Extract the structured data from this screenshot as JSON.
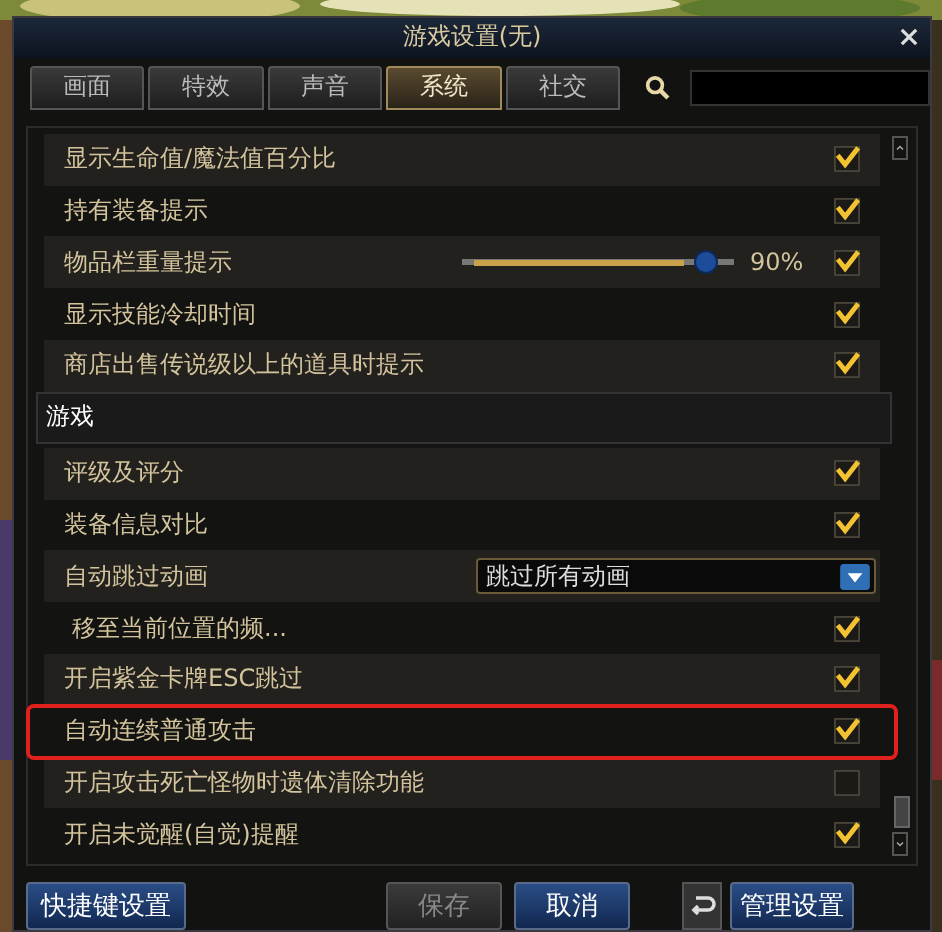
{
  "window": {
    "title": "游戏设置(无)"
  },
  "tabs": [
    {
      "label": "画面",
      "selected": false
    },
    {
      "label": "特效",
      "selected": false
    },
    {
      "label": "声音",
      "selected": false
    },
    {
      "label": "系统",
      "selected": true
    },
    {
      "label": "社交",
      "selected": false
    }
  ],
  "rows": [
    {
      "kind": "toggle",
      "label": "显示生命值/魔法值百分比",
      "checked": true
    },
    {
      "kind": "toggle",
      "label": "持有装备提示",
      "checked": true
    },
    {
      "kind": "slider",
      "label": "物品栏重量提示",
      "level": 0.85,
      "reading": "90%",
      "checked": true
    },
    {
      "kind": "toggle",
      "label": "显示技能冷却时间",
      "checked": true
    },
    {
      "kind": "toggle",
      "label": "商店出售传说级以上的道具时提示",
      "checked": true
    },
    {
      "kind": "section",
      "label": "游戏"
    },
    {
      "kind": "toggle",
      "label": "评级及评分",
      "checked": true
    },
    {
      "kind": "toggle",
      "label": "装备信息对比",
      "checked": true
    },
    {
      "kind": "dropdown",
      "label": "自动跳过动画",
      "value": "跳过所有动画",
      "children": [
        {
          "kind": "toggle",
          "label": "移至当前位置的频...",
          "checked": true
        }
      ]
    },
    {
      "kind": "toggle",
      "label": "开启紫金卡牌ESC跳过",
      "checked": true
    },
    {
      "kind": "toggle",
      "label": "自动连续普通攻击",
      "checked": true,
      "highlighted": true
    },
    {
      "kind": "toggle",
      "label": "开启攻击死亡怪物时遗体清除功能",
      "checked": false
    },
    {
      "kind": "toggle",
      "label": "开启未觉醒(自觉)提醒",
      "checked": true
    }
  ],
  "buttons": [
    {
      "label": "快捷键设置",
      "disabled": false
    },
    {
      "label": "保存",
      "disabled": true
    },
    {
      "label": "取消",
      "disabled": false
    },
    {
      "label": "管理设置",
      "disabled": false
    }
  ]
}
